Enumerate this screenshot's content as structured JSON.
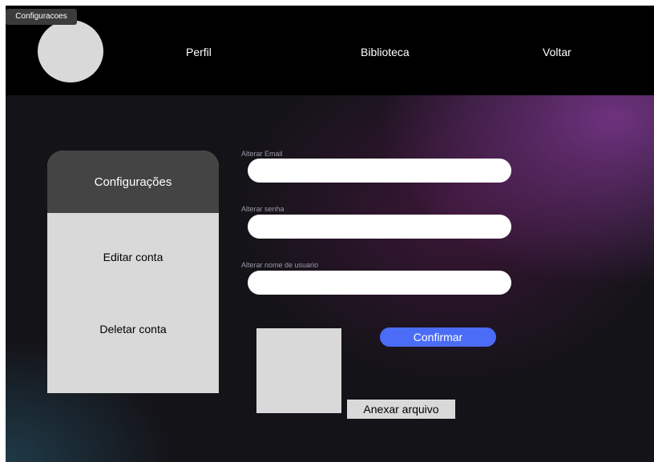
{
  "frame": {
    "tab_label": "Configuracoes"
  },
  "nav": {
    "perfil": "Perfil",
    "biblioteca": "Biblioteca",
    "voltar": "Voltar"
  },
  "sidebar": {
    "header": "Configurações",
    "items": [
      {
        "label": "Editar conta"
      },
      {
        "label": "Deletar conta"
      }
    ]
  },
  "form": {
    "email_label": "Alterar Email",
    "email_value": "",
    "senha_label": "Alterar senha",
    "senha_value": "",
    "usuario_label": "Alterar nome de usuario",
    "usuario_value": ""
  },
  "buttons": {
    "confirm": "Confirmar",
    "attach": "Anexar arquivo"
  },
  "colors": {
    "topbar": "#000000",
    "accent_button": "#4a6cf7",
    "panel_header": "#444444",
    "panel_body": "#d9d9d9"
  }
}
